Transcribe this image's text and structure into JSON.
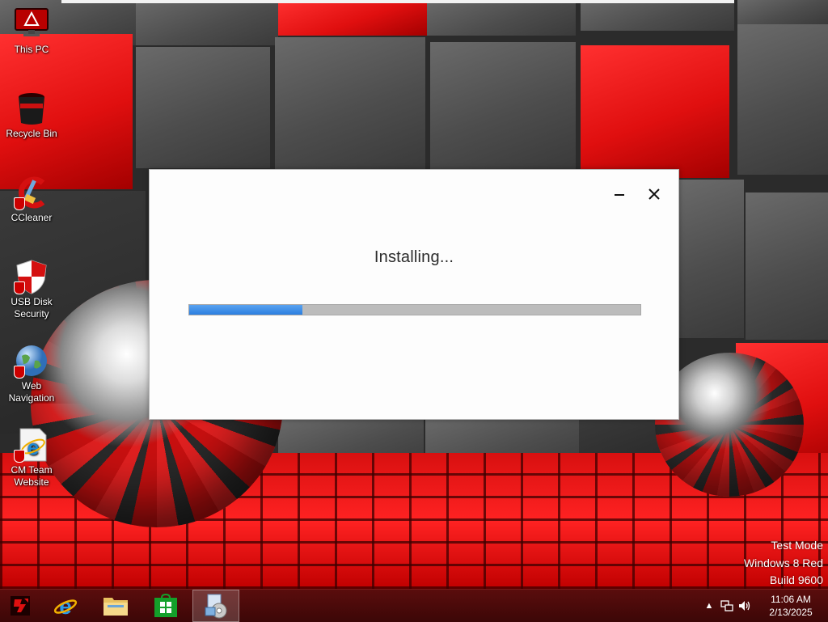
{
  "desktop": {
    "icons": [
      {
        "label": "This PC",
        "icon": "computer-icon"
      },
      {
        "label": "Recycle Bin",
        "icon": "recycle-bin-icon"
      },
      {
        "label": "CCleaner",
        "icon": "ccleaner-icon"
      },
      {
        "label": "USB Disk Security",
        "icon": "shield-icon"
      },
      {
        "label": "Web Navigation",
        "icon": "globe-icon"
      },
      {
        "label": "CM Team Website",
        "icon": "internet-explorer-icon"
      }
    ],
    "watermark": {
      "line1": "Test Mode",
      "line2": "Windows 8 Red",
      "line3": "Build 9600"
    }
  },
  "dialog": {
    "status_text": "Installing...",
    "progress_fraction": 0.25,
    "minimize_icon": "minimize-icon",
    "close_icon": "close-icon",
    "accent_color": "#2b7ee0"
  },
  "taskbar": {
    "pinned": [
      {
        "name": "start",
        "icon": "start-logo-icon"
      },
      {
        "name": "internet-explorer",
        "icon": "internet-explorer-icon"
      },
      {
        "name": "file-explorer",
        "icon": "folder-icon"
      },
      {
        "name": "store",
        "icon": "store-icon"
      },
      {
        "name": "installer",
        "icon": "installer-icon",
        "active": true
      }
    ],
    "tray": {
      "icons": [
        "show-hidden-icons-icon",
        "network-icon",
        "volume-icon"
      ],
      "time": "11:06 AM",
      "date": "2/13/2025"
    }
  },
  "colors": {
    "wallpaper_red": "#e00f0f",
    "wallpaper_gray": "#4d4d4d",
    "taskbar": "#4a0a0a"
  }
}
